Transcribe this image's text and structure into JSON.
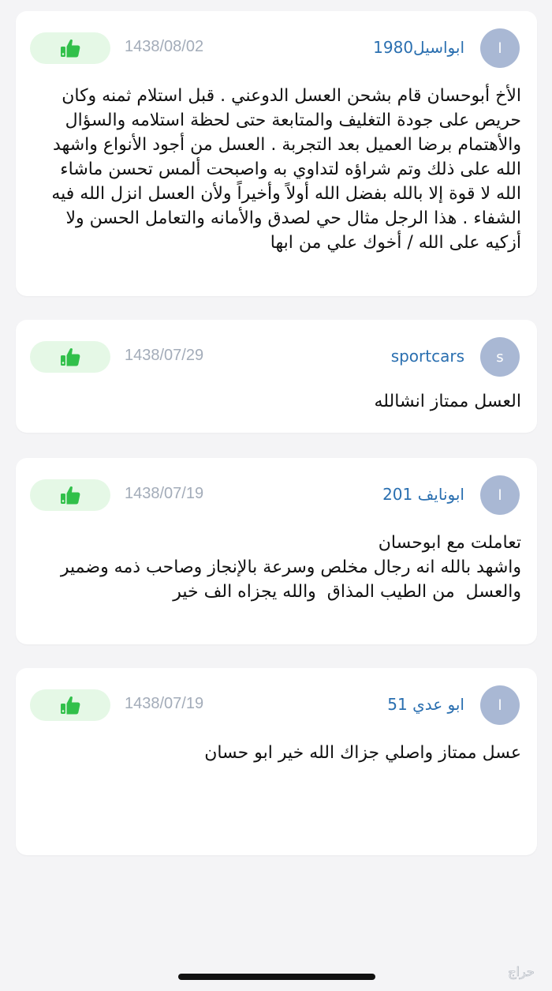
{
  "colors": {
    "background": "#f4f4f6",
    "card": "#ffffff",
    "username": "#2a6fb0",
    "date": "#a3acb9",
    "like_bg": "#e5f8e6",
    "like_icon": "#31c04a",
    "avatar_bg": "#a9b8d4"
  },
  "like_icon": "thumbs-up-icon",
  "comments": [
    {
      "avatar_letter": "ا",
      "username": "ابواسيل1980",
      "date": "1438/08/02",
      "body": "الأخ أبوحسان قام بشحن العسل الدوعني . قبل استلام ثمنه وكان حريص على جودة التغليف والمتابعة حتى لحظة استلامه والسؤال والأهتمام برضا العميل بعد التجربة . العسل من أجود الأنواع واشهد الله على ذلك وتم شراؤه لتداوي به واصبحت ألمس تحسن ماشاء الله لا قوة إلا بالله بفضل الله أولاً وأخيراً ولأن العسل انزل الله فيه الشفاء . هذا الرجل مثال حي لصدق والأمانه والتعامل الحسن ولا أزكيه على الله / أخوك علي من ابها"
    },
    {
      "avatar_letter": "s",
      "username": "sportcars",
      "date": "1438/07/29",
      "body": "العسل ممتاز انشالله"
    },
    {
      "avatar_letter": "ا",
      "username": "ابونايف 201",
      "date": "1438/07/19",
      "body": "تعاملت مع ابوحسان\nواشهد بالله انه رجال مخلص وسرعة بالإنجاز وصاحب ذمه وضمير\nوالعسل  من الطيب المذاق  والله يجزاه الف خير"
    },
    {
      "avatar_letter": "ا",
      "username": "ابو عدي 51",
      "date": "1438/07/19",
      "body": "عسل ممتاز واصلي جزاك الله خير ابو حسان"
    }
  ],
  "watermark_text": "حراج"
}
